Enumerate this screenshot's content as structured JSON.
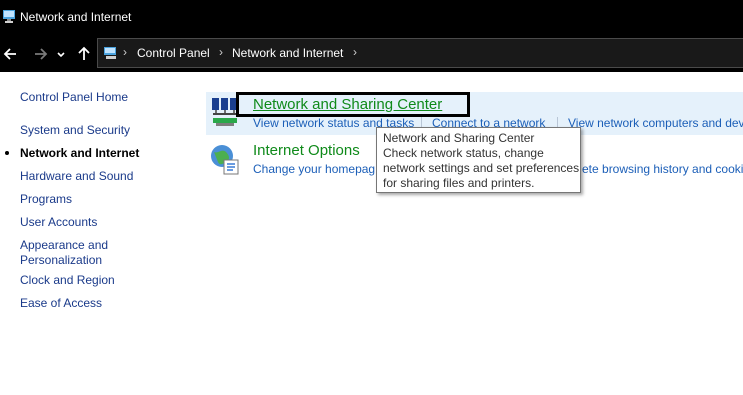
{
  "window": {
    "title": "Network and Internet",
    "icon": "control-panel-icon"
  },
  "nav": {
    "back_icon": "arrow-left-icon",
    "forward_icon": "arrow-right-icon",
    "recent_icon": "chevron-down-icon",
    "up_icon": "arrow-up-icon"
  },
  "breadcrumb": {
    "items": [
      "Control Panel",
      "Network and Internet"
    ],
    "separator": "›"
  },
  "sidebar": {
    "home": "Control Panel Home",
    "items": [
      {
        "label": "System and Security",
        "active": false
      },
      {
        "label": "Network and Internet",
        "active": true
      },
      {
        "label": "Hardware and Sound",
        "active": false
      },
      {
        "label": "Programs",
        "active": false
      },
      {
        "label": "User Accounts",
        "active": false
      },
      {
        "label": "Appearance and",
        "label2": "Personalization",
        "active": false
      },
      {
        "label": "Clock and Region",
        "active": false
      },
      {
        "label": "Ease of Access",
        "active": false
      }
    ]
  },
  "categories": [
    {
      "title": "Network and Sharing Center",
      "icon": "network-sharing-icon",
      "links": [
        "View network status and tasks",
        "Connect to a network",
        "View network computers and dev"
      ]
    },
    {
      "title": "Internet Options",
      "icon": "internet-options-icon",
      "links": [
        "Change your homepag",
        "ete browsing history and cookie"
      ]
    }
  ],
  "tooltip": {
    "lines": [
      "Network and Sharing Center",
      "Check network status, change",
      "network settings and set preferences",
      "for sharing files and printers."
    ]
  },
  "colors": {
    "title_green": "#0f8a1a",
    "link_blue": "#1c5fb8",
    "hover_bg": "#e5f1fb"
  }
}
